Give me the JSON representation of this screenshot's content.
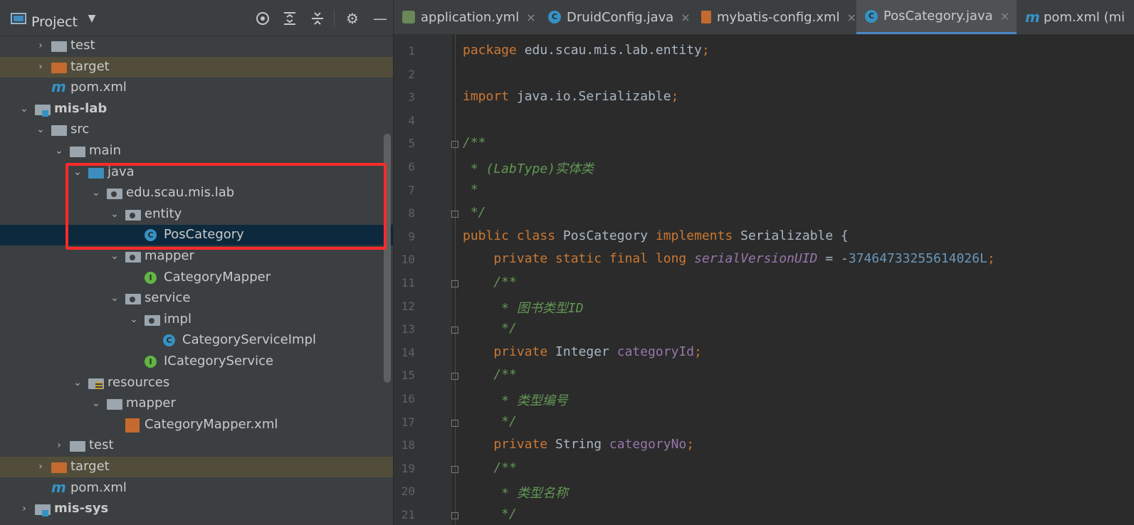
{
  "project_panel": {
    "title": "Project",
    "tree": [
      {
        "label": "test",
        "type": "folder-gray",
        "indent": 1,
        "arrow": "›",
        "style": ""
      },
      {
        "label": "target",
        "type": "folder-orange",
        "indent": 1,
        "arrow": "›",
        "style": "excluded"
      },
      {
        "label": "pom.xml",
        "type": "maven",
        "indent": 1,
        "arrow": "",
        "style": ""
      },
      {
        "label": "mis-lab",
        "type": "module",
        "indent": 0,
        "arrow": "⌄",
        "style": "bold"
      },
      {
        "label": "src",
        "type": "folder-gray",
        "indent": 1,
        "arrow": "⌄",
        "style": ""
      },
      {
        "label": "main",
        "type": "folder-gray",
        "indent": 2,
        "arrow": "⌄",
        "style": ""
      },
      {
        "label": "java",
        "type": "folder-blue",
        "indent": 3,
        "arrow": "⌄",
        "style": ""
      },
      {
        "label": "edu.scau.mis.lab",
        "type": "package",
        "indent": 4,
        "arrow": "⌄",
        "style": ""
      },
      {
        "label": "entity",
        "type": "package",
        "indent": 5,
        "arrow": "⌄",
        "style": ""
      },
      {
        "label": "PosCategory",
        "type": "class",
        "indent": 6,
        "arrow": "",
        "style": "selected"
      },
      {
        "label": "mapper",
        "type": "package",
        "indent": 5,
        "arrow": "⌄",
        "style": ""
      },
      {
        "label": "CategoryMapper",
        "type": "interface",
        "indent": 6,
        "arrow": "",
        "style": ""
      },
      {
        "label": "service",
        "type": "package",
        "indent": 5,
        "arrow": "⌄",
        "style": ""
      },
      {
        "label": "impl",
        "type": "package",
        "indent": 6,
        "arrow": "⌄",
        "style": ""
      },
      {
        "label": "CategoryServiceImpl",
        "type": "class",
        "indent": 7,
        "arrow": "",
        "style": ""
      },
      {
        "label": "ICategoryService",
        "type": "interface",
        "indent": 6,
        "arrow": "",
        "style": ""
      },
      {
        "label": "resources",
        "type": "resources",
        "indent": 3,
        "arrow": "⌄",
        "style": ""
      },
      {
        "label": "mapper",
        "type": "folder-gray",
        "indent": 4,
        "arrow": "⌄",
        "style": ""
      },
      {
        "label": "CategoryMapper.xml",
        "type": "xml",
        "indent": 5,
        "arrow": "",
        "style": ""
      },
      {
        "label": "test",
        "type": "folder-gray",
        "indent": 2,
        "arrow": "›",
        "style": ""
      },
      {
        "label": "target",
        "type": "folder-orange",
        "indent": 1,
        "arrow": "›",
        "style": "excluded"
      },
      {
        "label": "pom.xml",
        "type": "maven",
        "indent": 1,
        "arrow": "",
        "style": ""
      },
      {
        "label": "mis-sys",
        "type": "module",
        "indent": 0,
        "arrow": "›",
        "style": "bold"
      }
    ]
  },
  "tabs": [
    {
      "label": "application.yml",
      "icon": "yml",
      "active": false,
      "close": "×"
    },
    {
      "label": "DruidConfig.java",
      "icon": "class",
      "active": false,
      "close": "×"
    },
    {
      "label": "mybatis-config.xml",
      "icon": "xml",
      "active": false,
      "close": "×"
    },
    {
      "label": "PosCategory.java",
      "icon": "class",
      "active": true,
      "close": "×"
    },
    {
      "label": "pom.xml (mi",
      "icon": "m",
      "active": false,
      "close": ""
    }
  ],
  "code_lines": [
    [
      {
        "t": "package ",
        "c": "kw"
      },
      {
        "t": "edu.scau.mis.lab.entity",
        "c": ""
      },
      {
        "t": ";",
        "c": "kw"
      }
    ],
    [],
    [
      {
        "t": "import ",
        "c": "kw"
      },
      {
        "t": "java.io.Serializable",
        "c": ""
      },
      {
        "t": ";",
        "c": "kw"
      }
    ],
    [],
    [
      {
        "t": "/**",
        "c": "cm"
      }
    ],
    [
      {
        "t": " * (LabType)实体类",
        "c": "cm"
      }
    ],
    [
      {
        "t": " *",
        "c": "cm"
      }
    ],
    [
      {
        "t": " */",
        "c": "cm"
      }
    ],
    [
      {
        "t": "public class ",
        "c": "kw"
      },
      {
        "t": "PosCategory ",
        "c": ""
      },
      {
        "t": "implements ",
        "c": "kw"
      },
      {
        "t": "Serializable {",
        "c": ""
      }
    ],
    [
      {
        "t": "    private static final long ",
        "c": "kw"
      },
      {
        "t": "serialVersionUID",
        "c": "sfld"
      },
      {
        "t": " = -",
        "c": ""
      },
      {
        "t": "37464733255614026L",
        "c": "num"
      },
      {
        "t": ";",
        "c": "kw"
      }
    ],
    [
      {
        "t": "    /**",
        "c": "cm"
      }
    ],
    [
      {
        "t": "     * 图书类型ID",
        "c": "cm"
      }
    ],
    [
      {
        "t": "     */",
        "c": "cm"
      }
    ],
    [
      {
        "t": "    private ",
        "c": "kw"
      },
      {
        "t": "Integer ",
        "c": ""
      },
      {
        "t": "categoryId",
        "c": "fld"
      },
      {
        "t": ";",
        "c": "kw"
      }
    ],
    [
      {
        "t": "    /**",
        "c": "cm"
      }
    ],
    [
      {
        "t": "     * 类型编号",
        "c": "cm"
      }
    ],
    [
      {
        "t": "     */",
        "c": "cm"
      }
    ],
    [
      {
        "t": "    private ",
        "c": "kw"
      },
      {
        "t": "String ",
        "c": ""
      },
      {
        "t": "categoryNo",
        "c": "fld"
      },
      {
        "t": ";",
        "c": "kw"
      }
    ],
    [
      {
        "t": "    /**",
        "c": "cm"
      }
    ],
    [
      {
        "t": "     * 类型名称",
        "c": "cm"
      }
    ],
    [
      {
        "t": "     */",
        "c": "cm"
      }
    ]
  ],
  "fold_markers": [
    5,
    8,
    11,
    13,
    15,
    17,
    19,
    21
  ],
  "colors": {
    "selection": "#0d293e",
    "excluded": "#514d3a",
    "highlight_box": "#ff2a2a",
    "accent": "#4a88c7"
  }
}
